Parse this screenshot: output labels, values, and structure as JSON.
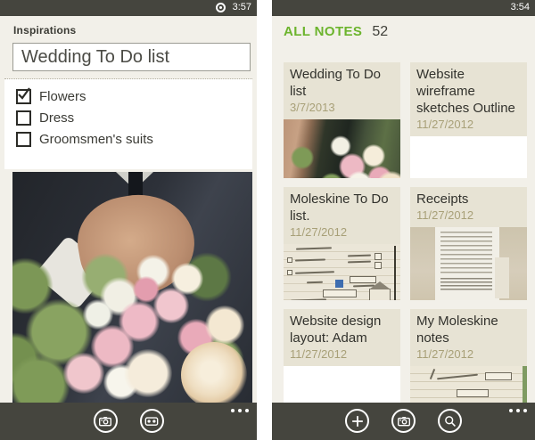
{
  "colors": {
    "bar": "#45453e",
    "screen_bg": "#f2f0e9",
    "tile_header": "#e7e3d4",
    "accent_green": "#6cb42d",
    "date_text": "#a8a078",
    "title_text": "#32322d"
  },
  "left_screen": {
    "status": {
      "time": "3:57"
    },
    "page_title": "Inspirations",
    "note_title": "Wedding To Do list",
    "checklist": [
      {
        "label": "Flowers",
        "checked": true
      },
      {
        "label": "Dress",
        "checked": false
      },
      {
        "label": "Groomsmen's suits",
        "checked": false
      }
    ],
    "photo": "wedding-bouquet-photo",
    "appbar": {
      "icons": [
        "camera-icon",
        "voice-memo-icon"
      ],
      "more": "more-icon"
    }
  },
  "right_screen": {
    "status": {
      "time": "3:54"
    },
    "header": {
      "title": "ALL NOTES",
      "count": "52"
    },
    "tiles": [
      {
        "title": "Wedding To Do list",
        "date": "3/7/2013",
        "thumb": "bouquet-photo"
      },
      {
        "title": "Website wireframe sketches Outline",
        "date": "11/27/2012",
        "thumb": "blank"
      },
      {
        "title": "Moleskine To Do list.",
        "date": "11/27/2012",
        "thumb": "handwritten-sketch"
      },
      {
        "title": "Receipts",
        "date": "11/27/2012",
        "thumb": "receipt-photo"
      },
      {
        "title": "Website design layout: Adam",
        "date": "11/27/2012",
        "thumb": "blank"
      },
      {
        "title": "My Moleskine notes",
        "date": "11/27/2012",
        "thumb": "moleskine-notes"
      }
    ],
    "appbar": {
      "icons": [
        "add-icon",
        "camera-icon",
        "search-icon"
      ],
      "more": "more-icon"
    }
  }
}
